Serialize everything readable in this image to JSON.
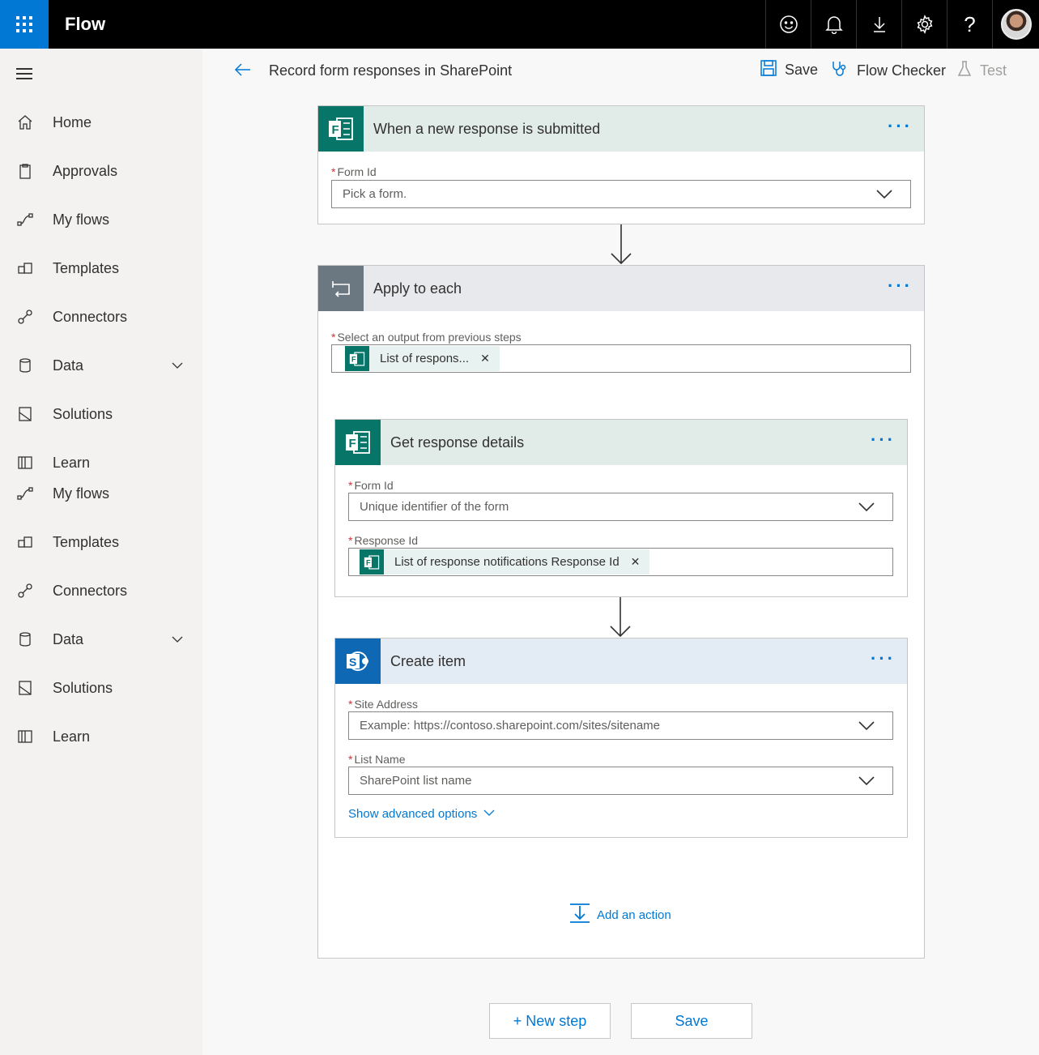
{
  "topbar": {
    "app_title": "Flow",
    "icons": [
      "smiley-icon",
      "bell-icon",
      "download-icon",
      "gear-icon",
      "help-icon"
    ],
    "help_glyph": "?"
  },
  "nav": {
    "items": [
      {
        "label": "Home",
        "icon": "home-icon"
      },
      {
        "label": "Approvals",
        "icon": "approvals-icon"
      },
      {
        "label": "My flows",
        "icon": "flows-icon"
      },
      {
        "label": "Templates",
        "icon": "templates-icon"
      },
      {
        "label": "Connectors",
        "icon": "connectors-icon"
      },
      {
        "label": "Data",
        "icon": "data-icon"
      },
      {
        "label": "Solutions",
        "icon": "solutions-icon"
      },
      {
        "label": "Learn",
        "icon": "learn-icon"
      },
      {
        "label": "My flows",
        "icon": "flows-icon"
      },
      {
        "label": "Templates",
        "icon": "templates-icon"
      },
      {
        "label": "Connectors",
        "icon": "connectors-icon"
      },
      {
        "label": "Data",
        "icon": "data-icon"
      },
      {
        "label": "Solutions",
        "icon": "solutions-icon"
      },
      {
        "label": "Learn",
        "icon": "learn-icon"
      }
    ]
  },
  "cmdbar": {
    "flow_name": "Record form responses in SharePoint",
    "save": "Save",
    "flow_checker": "Flow Checker",
    "test": "Test"
  },
  "trigger": {
    "title": "When a new response is submitted",
    "form_id_label": "Form Id",
    "form_id_placeholder": "Pick a form."
  },
  "apply_each": {
    "title": "Apply to each",
    "output_label": "Select an output from previous steps",
    "output_token": "List of respons..."
  },
  "get_details": {
    "title": "Get response details",
    "form_id_label": "Form Id",
    "form_id_placeholder": "Unique identifier of the form",
    "response_id_label": "Response Id",
    "response_id_token": "List of response notifications Response Id"
  },
  "create_item": {
    "title": "Create item",
    "site_label": "Site Address",
    "site_placeholder": "Example: https://contoso.sharepoint.com/sites/sitename",
    "list_label": "List Name",
    "list_placeholder": "SharePoint list name",
    "advanced": "Show advanced options"
  },
  "add_action": "Add an action",
  "footer": {
    "new_step": "+ New step",
    "save": "Save"
  },
  "colors": {
    "brand_blue": "#0078d4",
    "forms_green": "#077568",
    "sharepoint_blue": "#036c70",
    "trigger_header": "#e1ece9",
    "loop_header": "#e8e9ed",
    "loop_icon_bg": "#6b7781",
    "sharepoint_header": "#e3ebf4"
  }
}
